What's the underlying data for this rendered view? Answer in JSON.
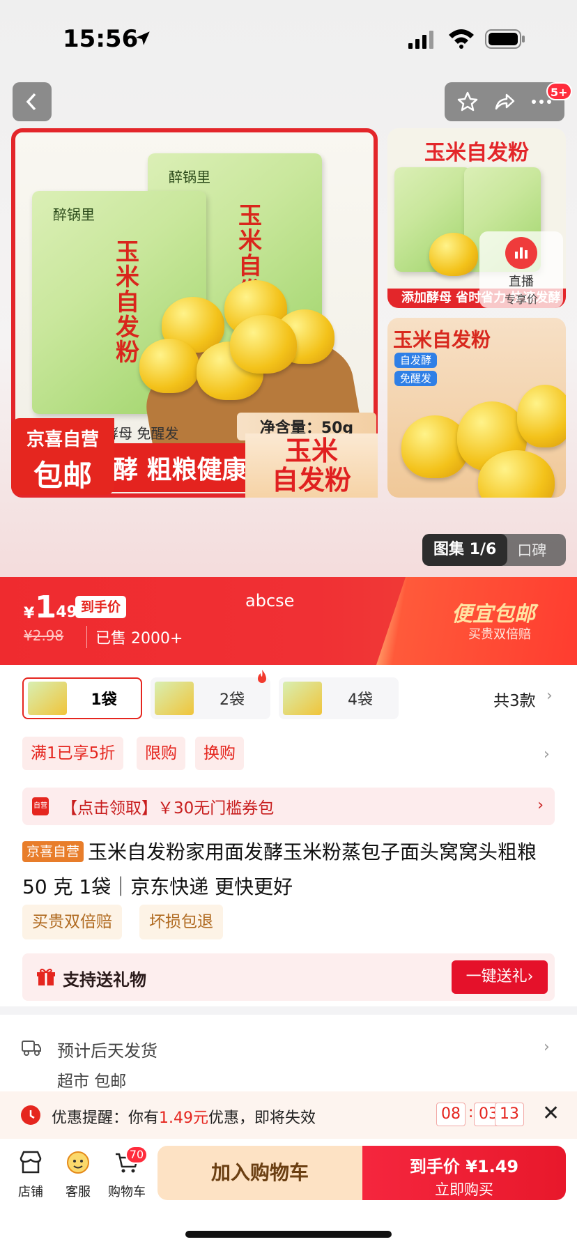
{
  "status_bar": {
    "time": "15:56"
  },
  "nav": {
    "message_badge": "5+"
  },
  "hero": {
    "brand": "醉锅里",
    "product_name_on_bag": "玉米自发粉",
    "yeast_note": "酵母 免醒发",
    "net_weight": "净含量：50g",
    "promo_text": "酵 粗粮健康",
    "promo_right": "玉米\n自发粉",
    "jx_badge_line1": "京喜自营",
    "jx_badge_line2": "包邮",
    "side1_title": "玉米自发粉",
    "side1_bar": "添加酵母 省时省力 快速发酵",
    "live_label": "直播",
    "live_sub": "专享价",
    "side2_title": "玉米自发粉",
    "side2_tag1": "自发酵",
    "side2_tag2": "免醒发",
    "gallery_label": "图集 1/6",
    "reviews_label": "口碑"
  },
  "price": {
    "currency": "¥",
    "integer": "1",
    "decimal": ".49",
    "daoshou_label": "到手价",
    "watermark": "abcse",
    "original": "¥2.98",
    "sold": "已售 2000+",
    "campaign_title": "便宜包邮",
    "campaign_sub": "买贵双倍赔"
  },
  "sku": {
    "options": [
      "1袋",
      "2袋",
      "4袋"
    ],
    "selected": "1袋",
    "total": "共3款"
  },
  "promos": [
    "满1已享5折",
    "限购",
    "换购"
  ],
  "coupon": {
    "icon_text": "自营",
    "text": "【点击领取】￥30无门槛券包"
  },
  "title": {
    "badge": "京喜自营",
    "text": "玉米自发粉家用面发酵玉米粉蒸包子面头窝窝头粗粮 50 克 1袋｜京东快递 更快更好"
  },
  "services": [
    "买贵双倍赔",
    "坏损包退"
  ],
  "gift": {
    "label": "支持送礼物",
    "button": "一键送礼›"
  },
  "shipping": {
    "eta": "预计后天发货",
    "tags": "超市   包邮"
  },
  "reminder": {
    "prefix": "优惠提醒：你有",
    "amount": "1.49元",
    "suffix": "优惠，即将失效",
    "hh": "08",
    "mm": "03",
    "ss": "13"
  },
  "bottom_bar": {
    "store": "店铺",
    "service": "客服",
    "cart": "购物车",
    "cart_count": "70",
    "add_to_cart": "加入购物车",
    "buy_price": "到手价 ¥1.49",
    "buy_now": "立即购买"
  },
  "colors": {
    "accent": "#e5261f",
    "campaign": "#ffe3a3",
    "add_cart_bg": "#fde2c4"
  }
}
